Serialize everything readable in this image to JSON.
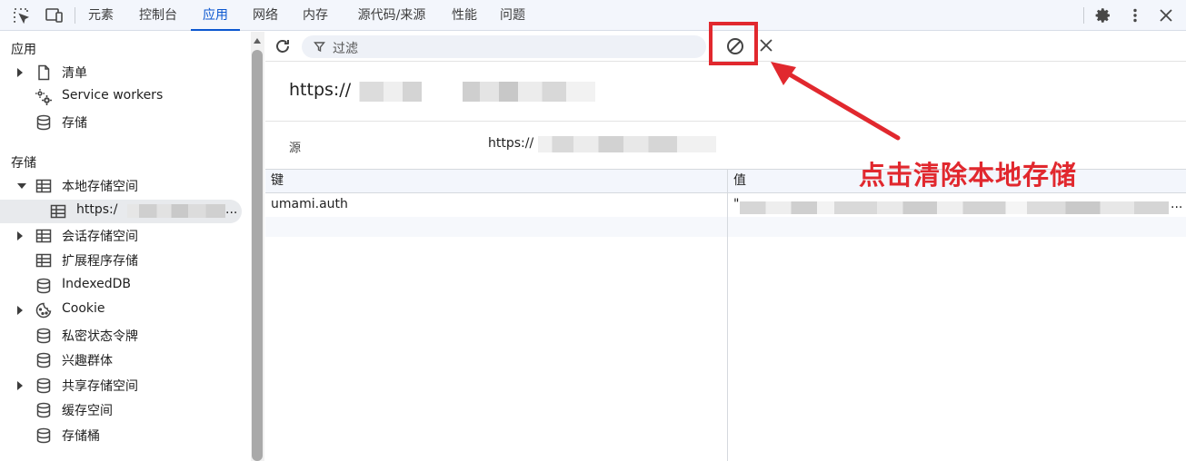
{
  "topbar": {
    "tabs": [
      "元素",
      "控制台",
      "应用",
      "网络",
      "内存",
      "源代码/来源",
      "性能",
      "问题"
    ],
    "active_tab": "应用",
    "icons": [
      "inspect-icon",
      "device-toolbar-icon",
      "gear-icon",
      "more-vertical-icon",
      "close-icon"
    ]
  },
  "sidebar": {
    "app_section": "应用",
    "app_items": [
      {
        "label": "清单",
        "icon": "file-icon",
        "expandable": true
      },
      {
        "label": "Service workers",
        "icon": "gears-icon",
        "expandable": false
      },
      {
        "label": "存储",
        "icon": "database-icon",
        "expandable": false
      }
    ],
    "storage_section": "存储",
    "storage_items": [
      {
        "label": "本地存储空间",
        "icon": "table-icon",
        "expandable": true,
        "expanded": true
      },
      {
        "label": "https:/",
        "icon": "table-icon",
        "selected": true,
        "suffix": "..."
      },
      {
        "label": "会话存储空间",
        "icon": "table-icon",
        "expandable": true
      },
      {
        "label": "扩展程序存储",
        "icon": "table-icon",
        "expandable": false
      },
      {
        "label": "IndexedDB",
        "icon": "database-icon",
        "expandable": false
      },
      {
        "label": "Cookie",
        "icon": "cookie-icon",
        "expandable": true
      },
      {
        "label": "私密状态令牌",
        "icon": "database-icon",
        "expandable": false
      },
      {
        "label": "兴趣群体",
        "icon": "database-icon",
        "expandable": false
      },
      {
        "label": "共享存储空间",
        "icon": "database-icon",
        "expandable": true
      },
      {
        "label": "缓存空间",
        "icon": "database-icon",
        "expandable": false
      },
      {
        "label": "存储桶",
        "icon": "database-icon",
        "expandable": false
      }
    ]
  },
  "toolbar": {
    "filter_placeholder": "过滤",
    "icons": [
      "refresh-icon",
      "filter-icon",
      "clear-all-icon",
      "close-icon"
    ]
  },
  "main": {
    "origin_title": "https://",
    "source_label": "源",
    "source_value": "https://",
    "columns": [
      "键",
      "值"
    ],
    "rows": [
      {
        "key": "umami.auth",
        "value_prefix": "\"",
        "value_suffix": "..."
      }
    ]
  },
  "annotation": {
    "text": "点击清除本地存储",
    "color": "#e1282e"
  },
  "colors": {
    "accent": "#0b57d0",
    "annotation_red": "#e1282e"
  }
}
